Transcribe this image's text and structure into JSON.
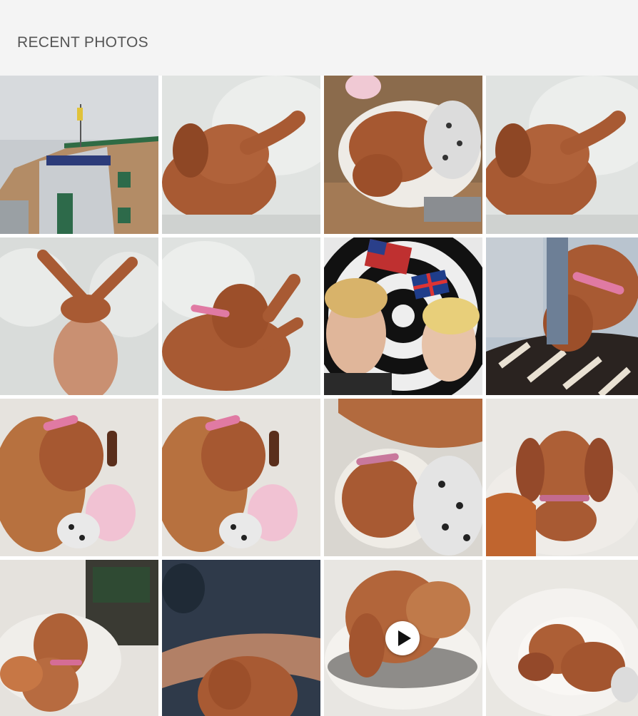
{
  "header": {
    "title": "RECENT PHOTOS"
  },
  "photos": [
    {
      "subject": "stadium-building",
      "video": false
    },
    {
      "subject": "puppy-sleeping-on-pillow",
      "video": false
    },
    {
      "subject": "puppy-in-bed-with-toy",
      "video": false
    },
    {
      "subject": "puppy-sleeping-on-pillow",
      "video": false
    },
    {
      "subject": "puppy-legs-up-on-bedding",
      "video": false
    },
    {
      "subject": "puppy-with-pink-collar-on-bedding",
      "video": false
    },
    {
      "subject": "meme-collage-with-flags",
      "video": false
    },
    {
      "subject": "puppy-on-lap",
      "video": false
    },
    {
      "subject": "puppy-with-pink-toy",
      "video": false
    },
    {
      "subject": "puppy-with-pink-toy",
      "video": false
    },
    {
      "subject": "puppy-sleeping-in-blanket",
      "video": false
    },
    {
      "subject": "puppy-sitting-in-bed",
      "video": false
    },
    {
      "subject": "puppy-in-bed-by-fireplace",
      "video": false
    },
    {
      "subject": "puppy-held-in-arm",
      "video": false
    },
    {
      "subject": "puppy-in-bed-video",
      "video": true
    },
    {
      "subject": "puppy-sleeping-in-fluffy-bed",
      "video": false
    }
  ],
  "colors": {
    "header_bg": "#f4f4f4",
    "title_text": "#555555",
    "grid_gap": "#ffffff",
    "puppy": "#a85a33",
    "bedding": "#e3e5e3"
  }
}
